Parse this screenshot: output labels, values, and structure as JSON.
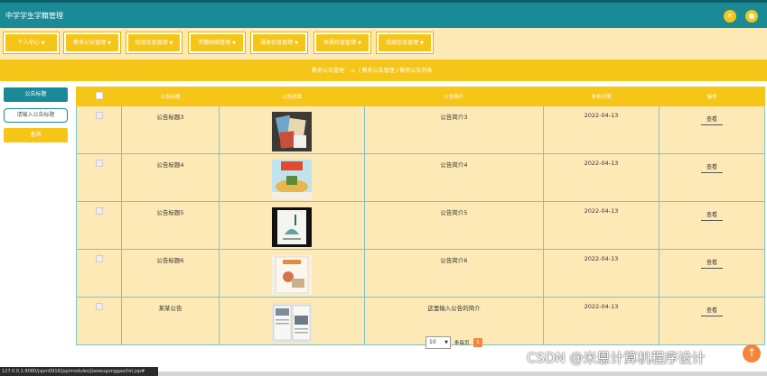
{
  "app": {
    "title": "中学学生学籍管理"
  },
  "header": {
    "icons": [
      "close-icon",
      "user-icon"
    ],
    "accent": "#f5c518",
    "bar_color": "#1a8a96"
  },
  "nav": {
    "items": [
      {
        "label": "个人中心"
      },
      {
        "label": "教务公告管理"
      },
      {
        "label": "班级信息管理"
      },
      {
        "label": "学籍档案管理"
      },
      {
        "label": "课表信息管理"
      },
      {
        "label": "体质检查管理"
      },
      {
        "label": "成绩信息管理"
      }
    ]
  },
  "breadcrumb": {
    "section": "教务公告管理",
    "path": "/ 教务公告管理 / 教务公告列表"
  },
  "sidebar": {
    "title_button": "公告标题",
    "search": {
      "placeholder": "请输入公告标题"
    },
    "query_button": "查询"
  },
  "table": {
    "headers": [
      "公告标题",
      "公告封面",
      "公告简介",
      "发布日期",
      "操作"
    ],
    "rows": [
      {
        "title": "公告标题3",
        "cover": "cover-3",
        "summary": "公告简介3",
        "date": "2022-04-13",
        "action": "查看"
      },
      {
        "title": "公告标题4",
        "cover": "cover-4",
        "summary": "公告简介4",
        "date": "2022-04-13",
        "action": "查看"
      },
      {
        "title": "公告标题5",
        "cover": "cover-5",
        "summary": "公告简介5",
        "date": "2022-04-13",
        "action": "查看"
      },
      {
        "title": "公告标题6",
        "cover": "cover-6",
        "summary": "公告简介6",
        "date": "2022-04-13",
        "action": "查看"
      },
      {
        "title": "某某公告",
        "cover": "cover-7",
        "summary": "这里输入公告的简介",
        "date": "2022-04-13",
        "action": "查看"
      }
    ]
  },
  "pagination": {
    "page_size": "10",
    "total_label": "条每页",
    "current_page": "1"
  },
  "statusbar": {
    "url": "127.0.0.1:8080/jspm0916/jsp/modules/jiaowugonggao/list.jsp#"
  },
  "watermark": "CSDN @米恩计算机程序设计",
  "fab": {
    "icon": "arrow-up-icon",
    "glyph": "↑"
  }
}
